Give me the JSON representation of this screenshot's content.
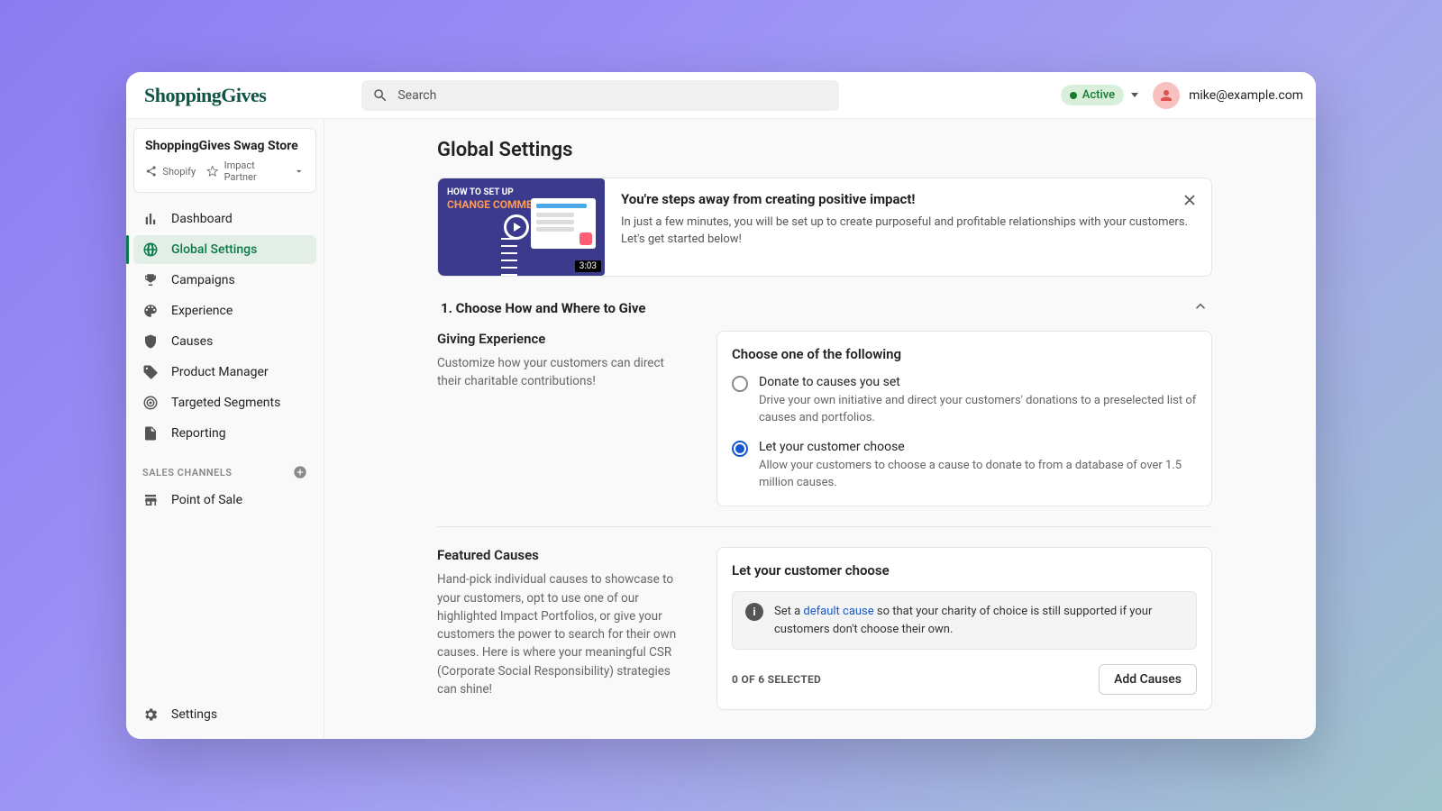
{
  "brand": "ShoppingGives",
  "search": {
    "placeholder": "Search"
  },
  "status": {
    "label": "Active"
  },
  "user": {
    "email": "mike@example.com"
  },
  "store": {
    "name": "ShoppingGives Swag Store",
    "platform": "Shopify",
    "tier": "Impact Partner"
  },
  "nav": [
    {
      "label": "Dashboard"
    },
    {
      "label": "Global Settings"
    },
    {
      "label": "Campaigns"
    },
    {
      "label": "Experience"
    },
    {
      "label": "Causes"
    },
    {
      "label": "Product Manager"
    },
    {
      "label": "Targeted Segments"
    },
    {
      "label": "Reporting"
    }
  ],
  "sales_channels_label": "SALES CHANNELS",
  "sales_channels": [
    {
      "label": "Point of Sale"
    }
  ],
  "settings_label": "Settings",
  "page": {
    "title": "Global Settings",
    "banner": {
      "video_overline": "HOW TO SET UP",
      "video_headline": "CHANGE COMMERCE",
      "video_duration": "3:03",
      "title": "You're steps away from creating positive impact!",
      "desc": "In just a few minutes, you will be set up to create purposeful and profitable relationships with your customers. Let's get started below!"
    },
    "section1": {
      "title": "1. Choose How and Where to Give",
      "giving": {
        "heading": "Giving Experience",
        "desc": "Customize how your customers can direct their charitable contributions!",
        "choose_heading": "Choose one of the following",
        "opt1_label": "Donate to causes you set",
        "opt1_desc": "Drive your own initiative and direct your customers' donations to a preselected list of causes and portfolios.",
        "opt2_label": "Let your customer choose",
        "opt2_desc": "Allow your customers to choose a cause to donate to from a database of over 1.5 million causes."
      },
      "featured": {
        "heading": "Featured Causes",
        "desc": "Hand-pick individual causes to showcase to your customers, opt to use one of our highlighted Impact Portfolios, or give your customers the power to search for their own causes. Here is where your meaningful CSR (Corporate Social Responsibility) strategies can shine!",
        "card_title": "Let your customer choose",
        "info_prefix": "Set a ",
        "info_link": "default cause",
        "info_suffix": " so that your charity of choice is still supported if your customers don't choose their own.",
        "selected": "0 OF 6 SELECTED",
        "add_btn": "Add Causes"
      }
    }
  }
}
